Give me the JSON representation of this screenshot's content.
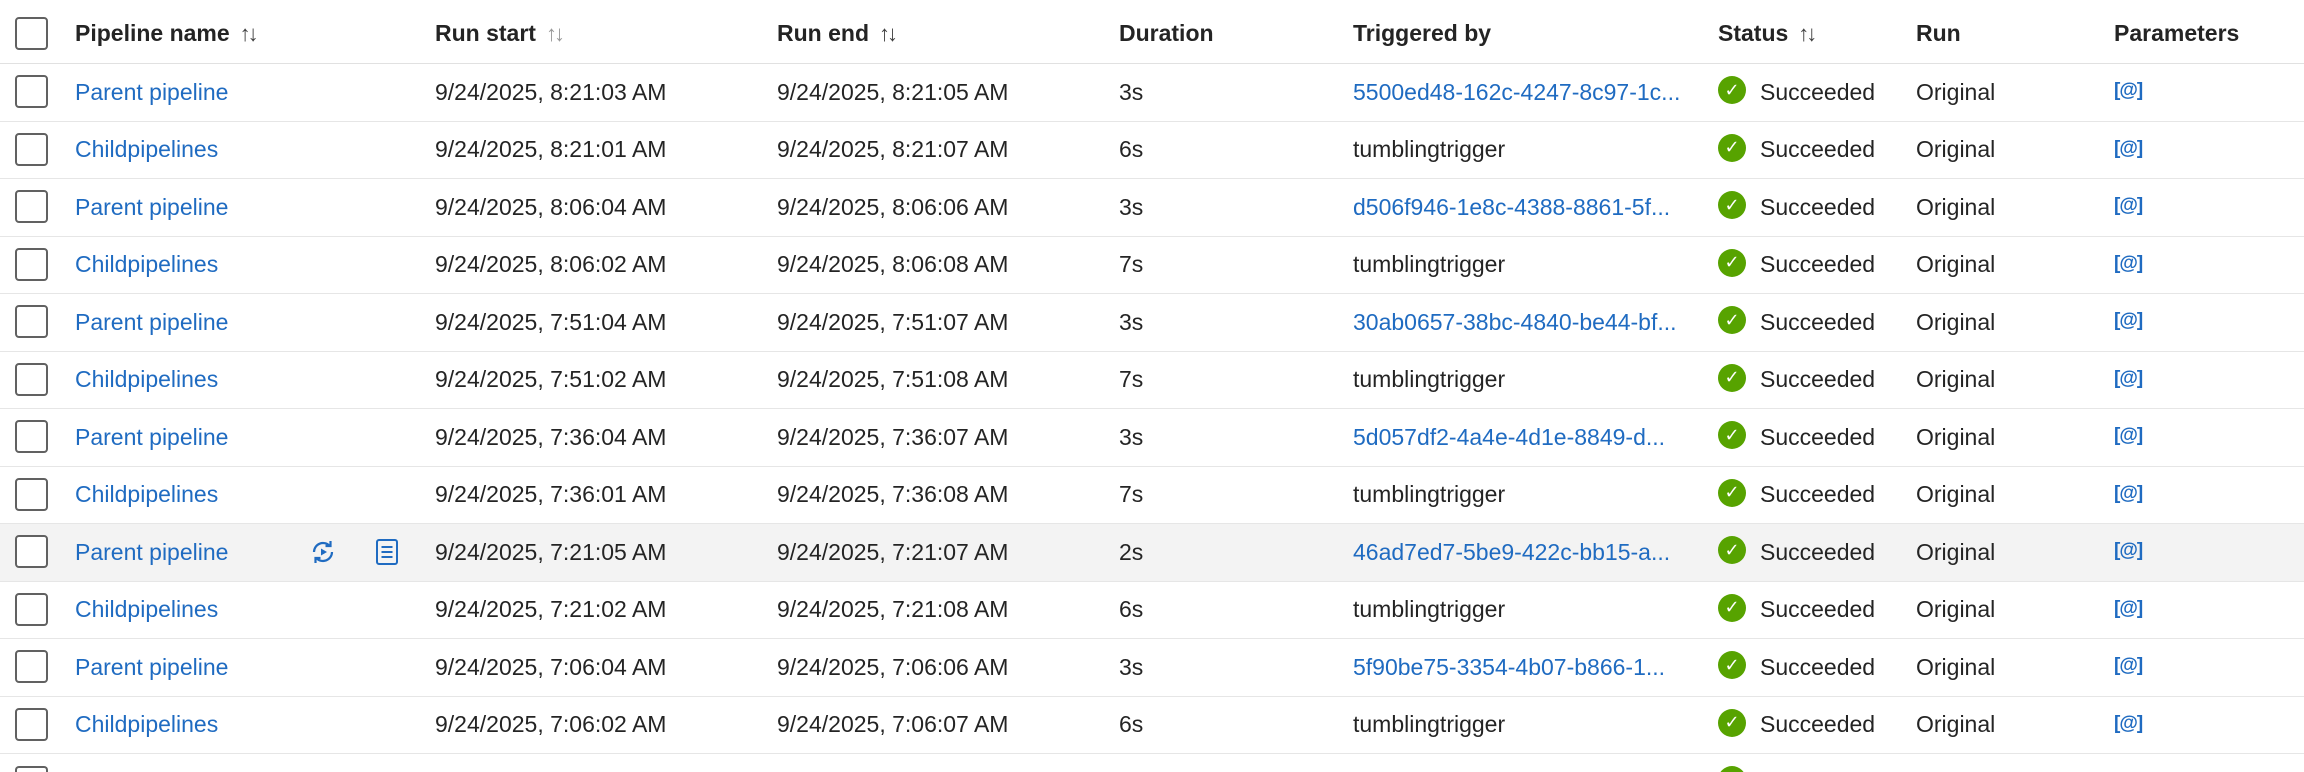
{
  "headers": {
    "pipeline_name": "Pipeline name",
    "run_start": "Run start",
    "run_end": "Run end",
    "duration": "Duration",
    "triggered_by": "Triggered by",
    "status": "Status",
    "run": "Run",
    "parameters": "Parameters",
    "sort_glyph": "↑↓"
  },
  "status_icon_glyph": "✓",
  "parameters_glyph": "[@]",
  "colors": {
    "link": "#1f6bc1",
    "success": "#57a300",
    "hover_row": "#f3f3f3"
  },
  "icons": {
    "rerun": "rerun-icon",
    "consumption": "consumption-icon",
    "success": "success-check-icon",
    "parameters": "parameters-icon"
  },
  "rows": [
    {
      "name": "Parent pipeline",
      "start": "9/24/2025, 8:21:03 AM",
      "end": "9/24/2025, 8:21:05 AM",
      "duration": "3s",
      "triggered_by": "5500ed48-162c-4247-8c97-1c...",
      "triggered_link": true,
      "status": "Succeeded",
      "run": "Original"
    },
    {
      "name": "Childpipelines",
      "start": "9/24/2025, 8:21:01 AM",
      "end": "9/24/2025, 8:21:07 AM",
      "duration": "6s",
      "triggered_by": "tumblingtrigger",
      "triggered_link": false,
      "status": "Succeeded",
      "run": "Original"
    },
    {
      "name": "Parent pipeline",
      "start": "9/24/2025, 8:06:04 AM",
      "end": "9/24/2025, 8:06:06 AM",
      "duration": "3s",
      "triggered_by": "d506f946-1e8c-4388-8861-5f...",
      "triggered_link": true,
      "status": "Succeeded",
      "run": "Original"
    },
    {
      "name": "Childpipelines",
      "start": "9/24/2025, 8:06:02 AM",
      "end": "9/24/2025, 8:06:08 AM",
      "duration": "7s",
      "triggered_by": "tumblingtrigger",
      "triggered_link": false,
      "status": "Succeeded",
      "run": "Original"
    },
    {
      "name": "Parent pipeline",
      "start": "9/24/2025, 7:51:04 AM",
      "end": "9/24/2025, 7:51:07 AM",
      "duration": "3s",
      "triggered_by": "30ab0657-38bc-4840-be44-bf...",
      "triggered_link": true,
      "status": "Succeeded",
      "run": "Original"
    },
    {
      "name": "Childpipelines",
      "start": "9/24/2025, 7:51:02 AM",
      "end": "9/24/2025, 7:51:08 AM",
      "duration": "7s",
      "triggered_by": "tumblingtrigger",
      "triggered_link": false,
      "status": "Succeeded",
      "run": "Original"
    },
    {
      "name": "Parent pipeline",
      "start": "9/24/2025, 7:36:04 AM",
      "end": "9/24/2025, 7:36:07 AM",
      "duration": "3s",
      "triggered_by": "5d057df2-4a4e-4d1e-8849-d...",
      "triggered_link": true,
      "status": "Succeeded",
      "run": "Original"
    },
    {
      "name": "Childpipelines",
      "start": "9/24/2025, 7:36:01 AM",
      "end": "9/24/2025, 7:36:08 AM",
      "duration": "7s",
      "triggered_by": "tumblingtrigger",
      "triggered_link": false,
      "status": "Succeeded",
      "run": "Original"
    },
    {
      "name": "Parent pipeline",
      "start": "9/24/2025, 7:21:05 AM",
      "end": "9/24/2025, 7:21:07 AM",
      "duration": "2s",
      "triggered_by": "46ad7ed7-5be9-422c-bb15-a...",
      "triggered_link": true,
      "status": "Succeeded",
      "run": "Original",
      "hovered": true
    },
    {
      "name": "Childpipelines",
      "start": "9/24/2025, 7:21:02 AM",
      "end": "9/24/2025, 7:21:08 AM",
      "duration": "6s",
      "triggered_by": "tumblingtrigger",
      "triggered_link": false,
      "status": "Succeeded",
      "run": "Original"
    },
    {
      "name": "Parent pipeline",
      "start": "9/24/2025, 7:06:04 AM",
      "end": "9/24/2025, 7:06:06 AM",
      "duration": "3s",
      "triggered_by": "5f90be75-3354-4b07-b866-1...",
      "triggered_link": true,
      "status": "Succeeded",
      "run": "Original"
    },
    {
      "name": "Childpipelines",
      "start": "9/24/2025, 7:06:02 AM",
      "end": "9/24/2025, 7:06:07 AM",
      "duration": "6s",
      "triggered_by": "tumblingtrigger",
      "triggered_link": false,
      "status": "Succeeded",
      "run": "Original"
    }
  ]
}
